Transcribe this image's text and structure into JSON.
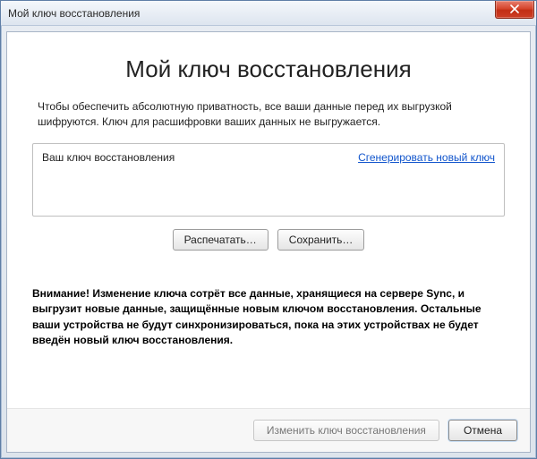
{
  "titlebar": {
    "title": "Мой ключ восстановления"
  },
  "main": {
    "heading": "Мой ключ восстановления",
    "description": "Чтобы обеспечить абсолютную приватность, все ваши данные перед их выгрузкой шифруются. Ключ для расшифровки ваших данных не выгружается.",
    "keybox": {
      "label": "Ваш ключ восстановления",
      "generate_link": "Сгенерировать новый ключ",
      "value": ""
    },
    "buttons": {
      "print": "Распечатать…",
      "save": "Сохранить…"
    },
    "warning": "Внимание! Изменение ключа сотрёт все данные, хранящиеся на сервере Sync, и выгрузит новые данные, защищённые новым ключом восстановления. Остальные ваши устройства не будут синхронизироваться, пока на этих устройствах не будет введён новый ключ восстановления."
  },
  "footer": {
    "change_key": "Изменить ключ восстановления",
    "cancel": "Отмена"
  }
}
